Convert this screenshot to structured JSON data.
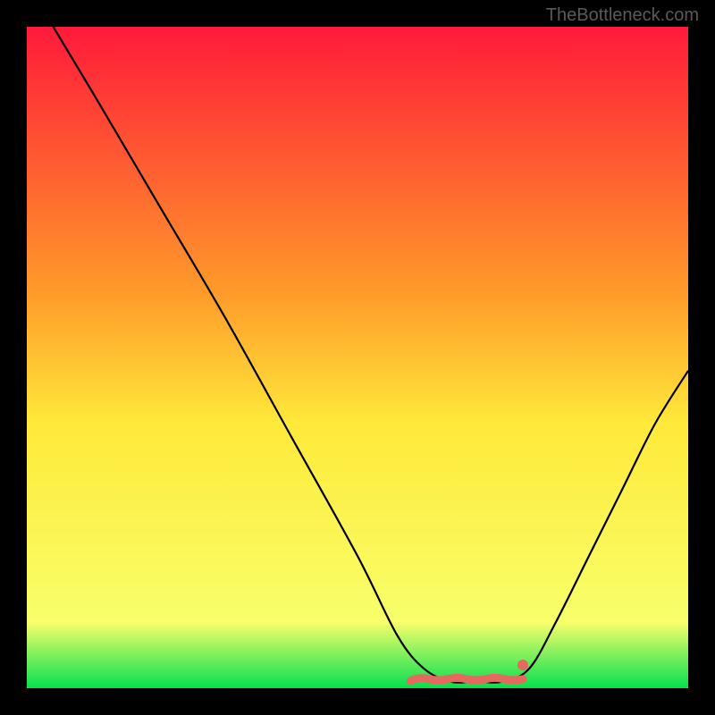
{
  "watermark": "TheBottleneck.com",
  "chart_data": {
    "type": "line",
    "title": "",
    "xlabel": "",
    "ylabel": "",
    "xlim": [
      0,
      100
    ],
    "ylim": [
      0,
      100
    ],
    "gradient_stops": [
      {
        "pct": 0,
        "color": "#ff1a3a"
      },
      {
        "pct": 40,
        "color": "#ff9a2a"
      },
      {
        "pct": 60,
        "color": "#ffe93a"
      },
      {
        "pct": 90,
        "color": "#f8ff6a"
      },
      {
        "pct": 100,
        "color": "#05e050"
      }
    ],
    "curve": [
      {
        "x": 4,
        "y": 100
      },
      {
        "x": 10,
        "y": 90
      },
      {
        "x": 20,
        "y": 73
      },
      {
        "x": 30,
        "y": 56
      },
      {
        "x": 40,
        "y": 38
      },
      {
        "x": 50,
        "y": 20
      },
      {
        "x": 56,
        "y": 8
      },
      {
        "x": 60,
        "y": 3
      },
      {
        "x": 64,
        "y": 1
      },
      {
        "x": 68,
        "y": 1
      },
      {
        "x": 72,
        "y": 1
      },
      {
        "x": 76,
        "y": 3
      },
      {
        "x": 80,
        "y": 10
      },
      {
        "x": 85,
        "y": 20
      },
      {
        "x": 90,
        "y": 30
      },
      {
        "x": 95,
        "y": 40
      },
      {
        "x": 100,
        "y": 48
      }
    ],
    "flat_segment_x": [
      58,
      75
    ],
    "flat_segment_y": 1.5,
    "flat_dot_x": 75,
    "accent_color": "#e6695f",
    "curve_color": "#000000"
  }
}
